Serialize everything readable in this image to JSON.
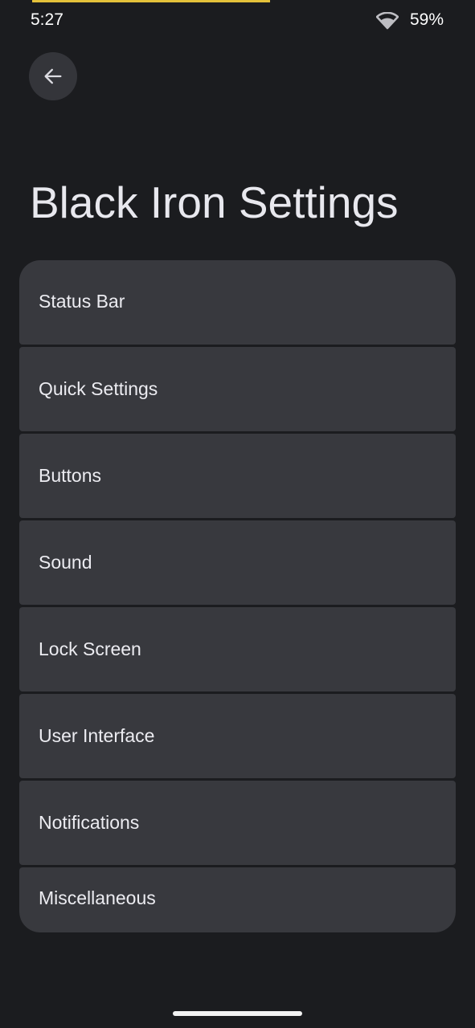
{
  "status_bar": {
    "time": "5:27",
    "battery": "59%",
    "progress_color": "#e4c13a"
  },
  "header": {
    "back_icon": "arrow-back-icon",
    "title": "Black Iron Settings"
  },
  "settings": {
    "items": [
      {
        "label": "Status Bar"
      },
      {
        "label": "Quick Settings"
      },
      {
        "label": "Buttons"
      },
      {
        "label": "Sound"
      },
      {
        "label": "Lock Screen"
      },
      {
        "label": "User Interface"
      },
      {
        "label": "Notifications"
      },
      {
        "label": "Miscellaneous"
      }
    ]
  },
  "colors": {
    "background": "#1b1c1f",
    "card": "#38393e",
    "text": "#ececf1"
  }
}
